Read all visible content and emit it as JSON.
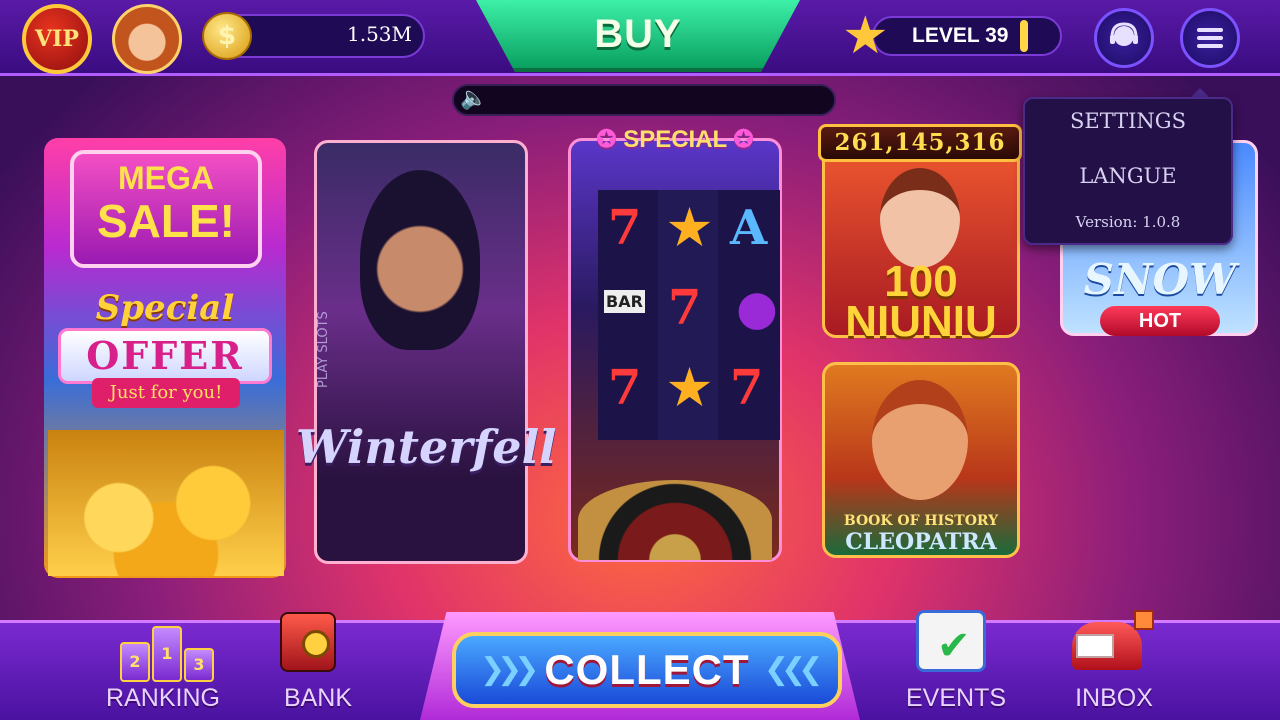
{
  "topbar": {
    "vip_label": "VIP",
    "coins": "1.53M",
    "coin_symbol": "$",
    "buy_label": "BUY",
    "level_label": "LEVEL 39",
    "icons": {
      "avatar": "avatar",
      "coin": "coin-icon",
      "star": "star-icon",
      "support": "support-icon",
      "menu": "hamburger-menu-icon",
      "volume": "volume-icon"
    }
  },
  "dropdown": {
    "items": [
      "SETTINGS",
      "LANGUE"
    ],
    "version": "Version: 1.0.8"
  },
  "cards": {
    "mega_sale": {
      "line1": "MEGA",
      "line2": "SALE!",
      "special": "Special",
      "offer": "OFFER",
      "just_for_you": "Just for you!"
    },
    "winterfell": {
      "side_label": "PLAY SLOTS",
      "title": "Winterfell"
    },
    "special_slot": {
      "banner": "SPECIAL",
      "symbols": [
        "7",
        "★",
        "A",
        "BAR",
        "7",
        "●",
        "7",
        "★",
        "7"
      ]
    },
    "niuniu": {
      "jackpot": "261,145,316",
      "title_top": "100",
      "title_bottom": "NIUNIU"
    },
    "cleopatra": {
      "subtitle": "BOOK OF HISTORY",
      "title": "CLEOPATRA"
    },
    "snow": {
      "title": "SNOW",
      "badge": "HOT"
    }
  },
  "bottom_nav": {
    "ranking": "RANKING",
    "bank": "BANK",
    "collect": "COLLECT",
    "events": "EVENTS",
    "inbox": "INBOX",
    "ranking_podium": [
      "2",
      "1",
      "3"
    ]
  },
  "colors": {
    "buy_green": "#0aa060",
    "accent_purple": "#5a1aa8",
    "collect_blue": "#1a4ad8",
    "gold": "#ffd040"
  }
}
